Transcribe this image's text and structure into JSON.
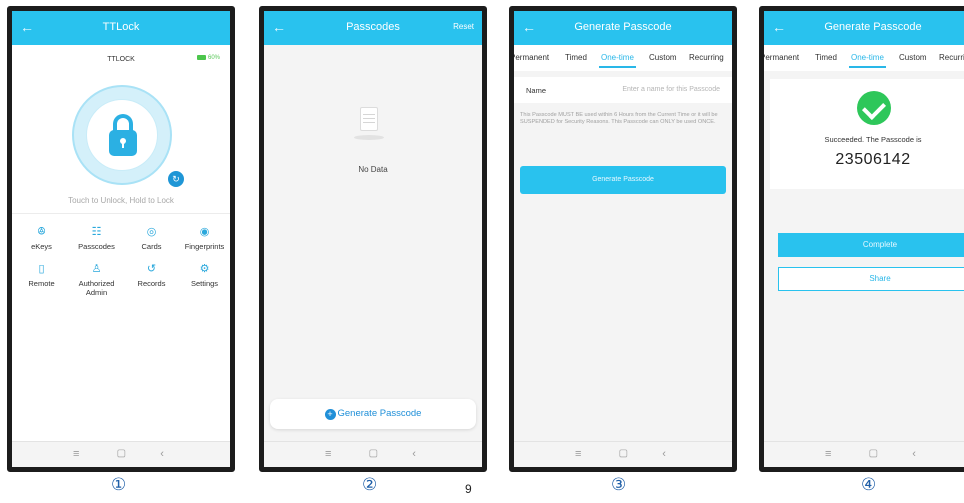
{
  "screen1": {
    "title": "TTLock",
    "back_icon": "back-arrow-icon",
    "lock_name": "TTLOCK",
    "battery": "60%",
    "touch_label": "Touch to Unlock, Hold to Lock",
    "menu": [
      {
        "label": "eKeys",
        "icon": "key-icon",
        "glyph": "ꔮ"
      },
      {
        "label": "Passcodes",
        "icon": "passcode-icon",
        "glyph": "☷"
      },
      {
        "label": "Cards",
        "icon": "card-icon",
        "glyph": "◎"
      },
      {
        "label": "Fingerprints",
        "icon": "fingerprint-icon",
        "glyph": "◉"
      },
      {
        "label": "Remote",
        "icon": "remote-icon",
        "glyph": "▯"
      },
      {
        "label": "Authorized Admin",
        "icon": "admin-icon",
        "glyph": "♙"
      },
      {
        "label": "Records",
        "icon": "records-icon",
        "glyph": "↺"
      },
      {
        "label": "Settings",
        "icon": "settings-icon",
        "glyph": "⚙"
      }
    ],
    "step": "①"
  },
  "screen2": {
    "title": "Passcodes",
    "reset": "Reset",
    "empty_text": "No Data",
    "generate_label": "Generate Passcode",
    "step": "②"
  },
  "screen3": {
    "title": "Generate Passcode",
    "tabs": [
      "Permanent",
      "Timed",
      "One-time",
      "Custom",
      "Recurring"
    ],
    "active_tab": "One-time",
    "name_label": "Name",
    "name_placeholder": "Enter a name for this Passcode",
    "notice": "This Passcode MUST BE used within 6 Hours from the Current Time or it will be SUSPENDED for Security Reasons. This Passcode can ONLY be used ONCE.",
    "generate_button": "Generate Passcode",
    "step": "③"
  },
  "screen4": {
    "title": "Generate Passcode",
    "tabs": [
      "Permanent",
      "Timed",
      "One-time",
      "Custom",
      "Recurring"
    ],
    "active_tab": "One-time",
    "success_text": "Succeeded. The Passcode is",
    "passcode": "23506142",
    "complete_button": "Complete",
    "share_button": "Share",
    "step": "④"
  },
  "navbar": {
    "menu": "≡",
    "home": "▢",
    "back": "‹"
  },
  "page_number": "9",
  "colors": {
    "accent": "#29c2ee",
    "success": "#2ec75a"
  }
}
